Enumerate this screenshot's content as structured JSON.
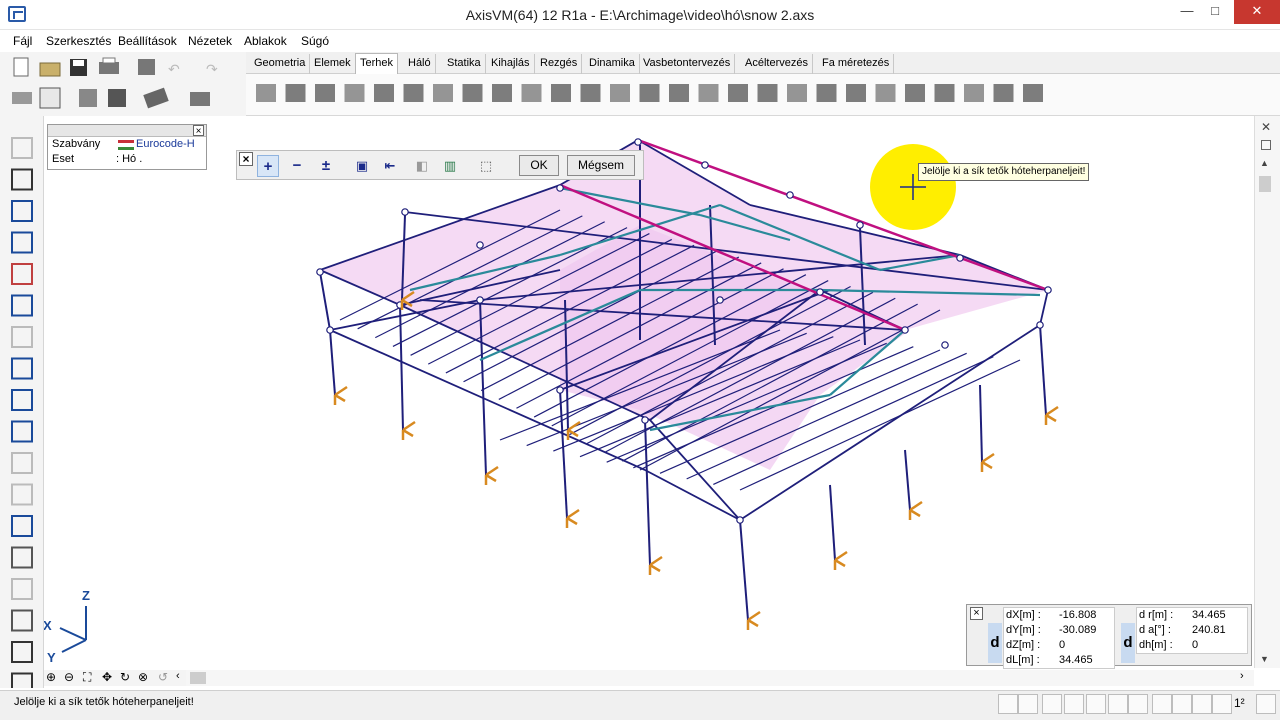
{
  "window": {
    "title": "AxisVM(64) 12 R1a - E:\\Archimage\\video\\hó\\snow 2.axs",
    "minimize": "—",
    "maximize": "□",
    "close": "✕"
  },
  "menu": [
    "Fájl",
    "Szerkesztés",
    "Beállítások",
    "Nézetek",
    "Ablakok",
    "Súgó"
  ],
  "tabs": [
    {
      "label": "Geometria",
      "active": false
    },
    {
      "label": "Elemek",
      "active": false
    },
    {
      "label": "Terhek",
      "active": true
    },
    {
      "label": "Háló",
      "active": false
    },
    {
      "label": "Statika",
      "active": false
    },
    {
      "label": "Kihajlás",
      "active": false
    },
    {
      "label": "Rezgés",
      "active": false
    },
    {
      "label": "Dinamika",
      "active": false
    },
    {
      "label": "Vasbetontervezés",
      "active": false
    },
    {
      "label": "Acéltervezés",
      "active": false
    },
    {
      "label": "Fa méretezés",
      "active": false
    }
  ],
  "info": {
    "close": "×",
    "standard_label": "Szabvány",
    "standard_value": "Eurocode-H",
    "case_label": "Eset",
    "case_value": ": Hó ."
  },
  "selection_toolbar": {
    "close": "×",
    "plus": "+",
    "minus": "−",
    "toggle": "±",
    "ok": "OK",
    "cancel": "Mégsem"
  },
  "tooltip": "Jelölje ki a sík tetők hóteherpaneljeit!",
  "coords": {
    "d_letter": "d",
    "dX_label": "dX[m] :",
    "dX": "-16.808",
    "dY_label": "dY[m] :",
    "dY": "-30.089",
    "dZ_label": "dZ[m] :",
    "dZ": "0",
    "dL_label": "dL[m] :",
    "dL": "34.465",
    "dr_label": "d r[m] :",
    "dr": "34.465",
    "da_label": "d a[°] :",
    "da": "240.81",
    "dh_label": "dh[m] :",
    "dh": "0",
    "close": "×"
  },
  "axes": {
    "x": "X",
    "y": "Y",
    "z": "Z"
  },
  "status": {
    "message": "Jelölje ki a sík tetők hóteherpaneljeit!",
    "scale_label": "1²"
  },
  "colors": {
    "structure": "#1f1f7a",
    "roof_fill": "#f3d4f2",
    "ridge": "#c01080",
    "purlin": "#2a8a9a",
    "support": "#d88a20",
    "cursor_halo": "#ffee00"
  }
}
